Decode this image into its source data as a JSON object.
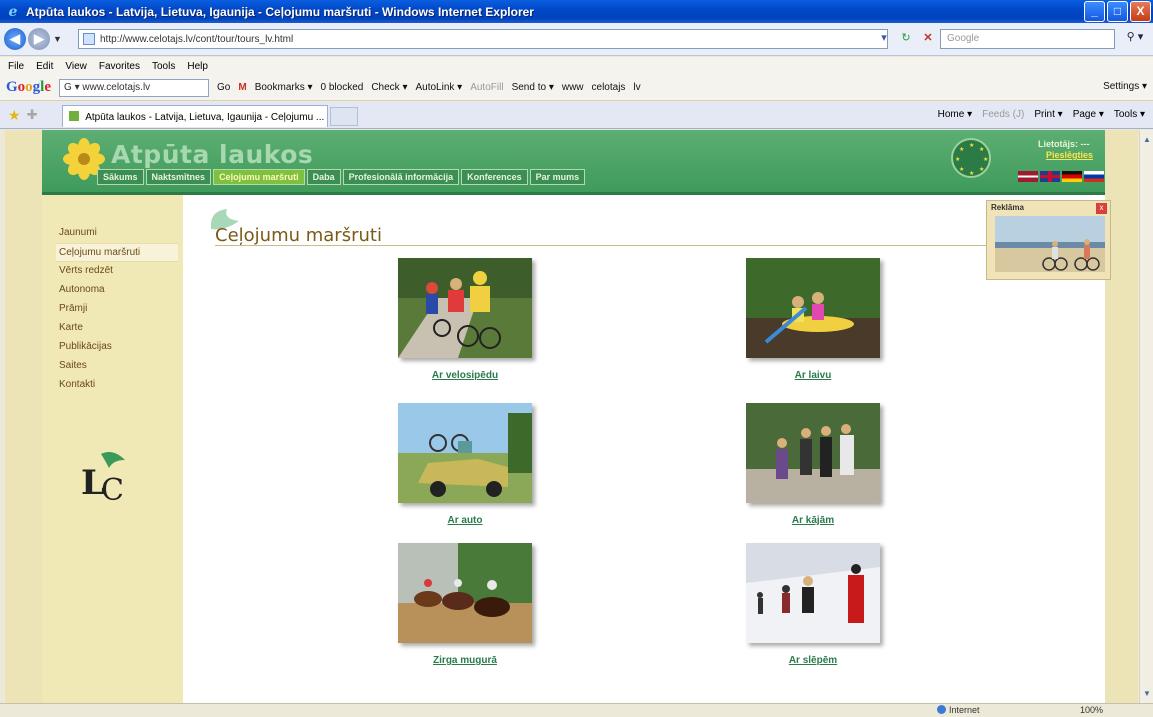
{
  "window": {
    "title": "Atpūta laukos - Latvija, Lietuva, Igaunija - Ceļojumu maršruti - Windows Internet Explorer",
    "minimize": "_",
    "maximize": "□",
    "close": "X"
  },
  "address": {
    "url": "http://www.celotajs.lv/cont/tour/tours_lv.html",
    "search_placeholder": "Google"
  },
  "menu": [
    "File",
    "Edit",
    "View",
    "Favorites",
    "Tools",
    "Help"
  ],
  "google_toolbar": {
    "logo": "Google",
    "search_value": "G ▾ www.celotajs.lv",
    "items": [
      "Go",
      "Bookmarks ▾",
      "0 blocked",
      "Check ▾",
      "AutoLink ▾",
      "AutoFill",
      "Send to ▾",
      "www",
      "celotajs",
      "lv"
    ],
    "settings": "Settings ▾"
  },
  "tabs": {
    "active_tab": "Atpūta laukos - Latvija, Lietuva, Igaunija - Ceļojumu ...",
    "commands": [
      "Home ▾",
      "Feeds (J)",
      "Print ▾",
      "Page ▾",
      "Tools ▾"
    ]
  },
  "site": {
    "name": "Atpūta laukos",
    "nav": [
      {
        "label": "Sākums",
        "active": false
      },
      {
        "label": "Naktsmītnes",
        "active": false
      },
      {
        "label": "Ceļojumu maršruti",
        "active": true
      },
      {
        "label": "Daba",
        "active": false
      },
      {
        "label": "Profesionālā informācija",
        "active": false
      },
      {
        "label": "Konferences",
        "active": false
      },
      {
        "label": "Par mums",
        "active": false
      }
    ],
    "user_label": "Lietotājs: ---",
    "login_link": "Pieslēgties",
    "sidebar": [
      {
        "label": "Jaunumi",
        "active": false
      },
      {
        "label": "Ceļojumu maršruti",
        "active": true
      },
      {
        "label": "Vērts redzēt",
        "active": false
      },
      {
        "label": "Autonoma",
        "active": false
      },
      {
        "label": "Prāmji",
        "active": false
      },
      {
        "label": "Karte",
        "active": false
      },
      {
        "label": "Publikācijas",
        "active": false
      },
      {
        "label": "Saites",
        "active": false
      },
      {
        "label": "Kontakti",
        "active": false
      }
    ],
    "heading": "Ceļojumu maršruti",
    "routes": [
      {
        "caption": "Ar velosipēdu",
        "photo": "cycling-photo"
      },
      {
        "caption": "Ar laivu",
        "photo": "canoe-photo"
      },
      {
        "caption": "Ar auto",
        "photo": "car-photo"
      },
      {
        "caption": "Ar kājām",
        "photo": "hiking-photo"
      },
      {
        "caption": "Zirga mugurā",
        "photo": "horse-riding-photo"
      },
      {
        "caption": "Ar slēpēm",
        "photo": "skiing-photo"
      }
    ],
    "ad": {
      "title": "Reklāma",
      "close": "x"
    }
  },
  "status": {
    "zone": "Internet",
    "zoom": "100%"
  },
  "colors": {
    "header_green": "#4aa366",
    "active_nav": "#7ec040",
    "sidebar_bg": "#f0e8b5",
    "link_green": "#2a7a4a",
    "heading_brown": "#7a5a18"
  }
}
